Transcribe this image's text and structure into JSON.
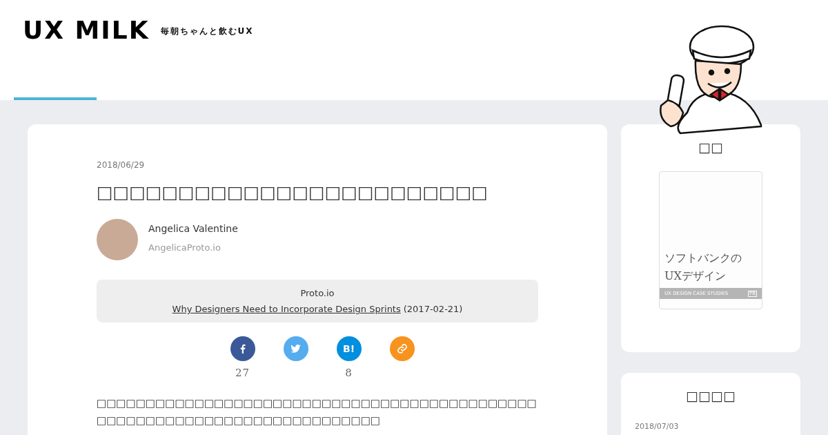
{
  "header": {
    "logo": "UX MILK",
    "tagline": "毎朝ちゃんと飲むUX",
    "tabs": [
      {
        "selected": true
      }
    ]
  },
  "article": {
    "date": "2018/06/29",
    "title": "□□□□□□□□□□□□□□□□□□□□□□□□",
    "author": {
      "name": "Angelica Valentine",
      "site": "AngelicaProto.io"
    },
    "source": {
      "publisher": "Proto.io",
      "link": "Why Designers Need to Incorporate Design Sprints",
      "date": "(2017-02-21)"
    },
    "shares": [
      {
        "kind": "facebook",
        "count": "27"
      },
      {
        "kind": "twitter"
      },
      {
        "kind": "hatena",
        "label": "B!",
        "count": "8"
      },
      {
        "kind": "link"
      }
    ],
    "body": "□□□□□□□□□□□□□□□□□□□□□□□□□□□□□□□□□□□□□□□□□□□□□□□□□□□□□□□□□□□□□□□□□□□□□□□□□□"
  },
  "sidebar": [
    {
      "heading": "□□",
      "book": {
        "title_line1": "ソフトバンクの",
        "title_line2": "UXデザイン",
        "series": "UX DESIGN CASE STUDIES",
        "badge": "PB"
      }
    },
    {
      "heading": "□□□□",
      "date": "2018/07/03"
    }
  ]
}
